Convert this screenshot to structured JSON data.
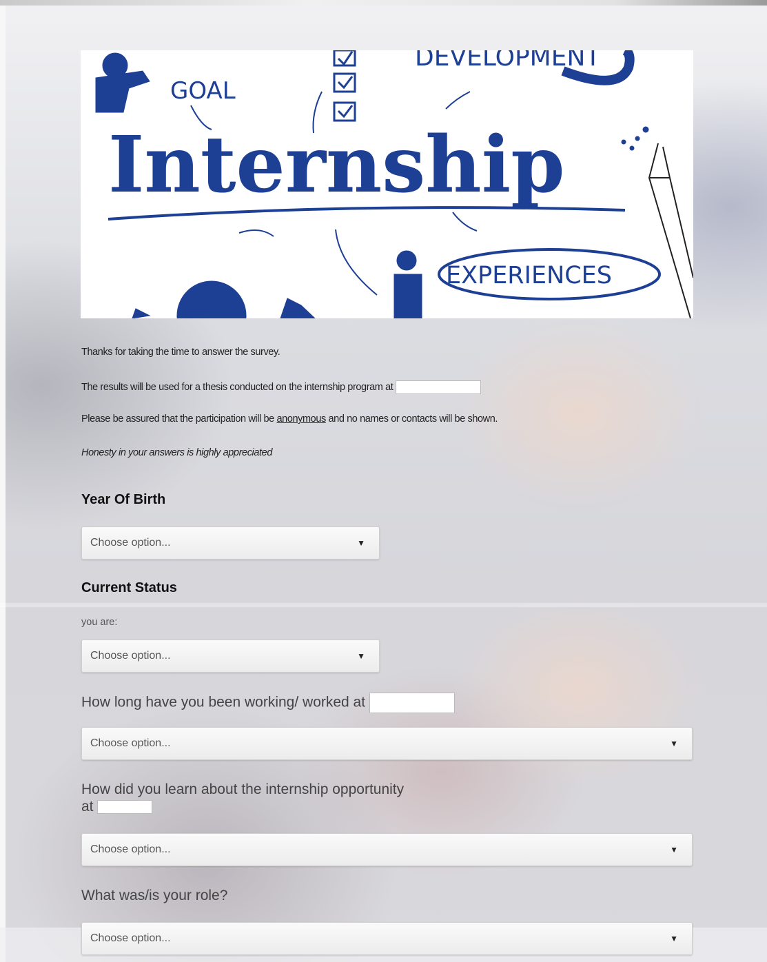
{
  "banner": {
    "words": [
      "GOAL",
      "DEVELOPMENT",
      "Internship",
      "EXPERIENCES"
    ],
    "accent_color": "#1d3f94"
  },
  "intro": {
    "line1": "Thanks for taking the time to answer the survey.",
    "line2": "The results will be used for a thesis conducted on the internship program at",
    "line3_pre": "Please be assured that the participation will be ",
    "line3_link": "anonymous",
    "line3_post": " and no names or contacts will be shown.",
    "line4": "Honesty in your answers is highly appreciated"
  },
  "questions": {
    "year_of_birth": {
      "label": "Year Of Birth",
      "value": "Choose option..."
    },
    "current_status": {
      "label": "Current Status",
      "sublabel": "you are:",
      "value": "Choose option..."
    },
    "how_long": {
      "label": "How long have you been working/ worked at",
      "value": "Choose option..."
    },
    "how_learn": {
      "label_line1": "How did you learn about the internship opportunity",
      "label_line2": "at",
      "value": "Choose option..."
    },
    "role": {
      "label": "What was/is your role?",
      "value": "Choose option..."
    }
  },
  "icons": {
    "dropdown": "triangle-down-icon",
    "checkbox": "checkmark-icon"
  }
}
